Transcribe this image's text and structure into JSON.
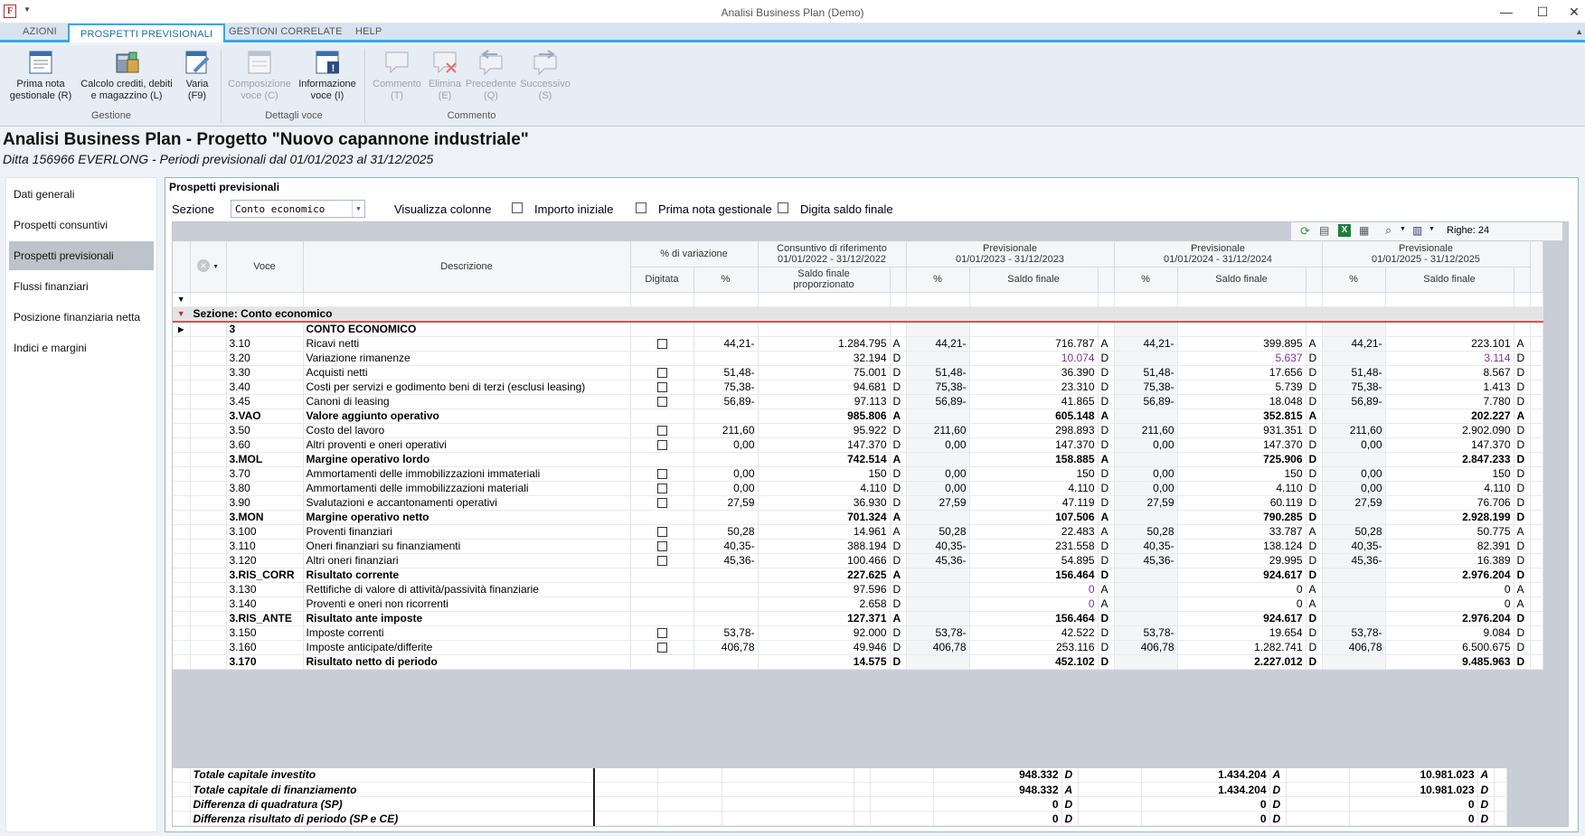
{
  "window": {
    "title": "Analisi Business Plan  (Demo)",
    "app_icon": "F",
    "controls": [
      "minimize-icon",
      "maximize-icon",
      "close-icon"
    ]
  },
  "ribbon_tabs": [
    "AZIONI",
    "PROSPETTI PREVISIONALI",
    "GESTIONI CORRELATE",
    "HELP"
  ],
  "ribbon": {
    "buttons": [
      {
        "l1": "Prima nota",
        "l2": "gestionale (R)",
        "icon": "document-icon"
      },
      {
        "l1": "Calcolo crediti, debiti",
        "l2": "e magazzino (L)",
        "icon": "calculator-icon"
      },
      {
        "l1": "Varia",
        "l2": "(F9)",
        "icon": "edit-icon"
      },
      {
        "l1": "Composizione",
        "l2": "voce (C)",
        "icon": "composition-icon"
      },
      {
        "l1": "Informazione",
        "l2": "voce (I)",
        "icon": "info-icon"
      },
      {
        "l1": "Commento",
        "l2": "(T)",
        "icon": "comment-icon"
      },
      {
        "l1": "Elimina",
        "l2": "(E)",
        "icon": "delete-comment-icon"
      },
      {
        "l1": "Precedente",
        "l2": "(Q)",
        "icon": "previous-icon"
      },
      {
        "l1": "Successivo",
        "l2": "(S)",
        "icon": "next-icon"
      }
    ],
    "groups": [
      "Gestione",
      "Dettagli voce",
      "Commento"
    ]
  },
  "header": {
    "title": "Analisi Business Plan - Progetto \"Nuovo capannone industriale\"",
    "subtitle": "Ditta 156966 EVERLONG - Periodi previsionali dal 01/01/2023 al 31/12/2025"
  },
  "nav": [
    "Dati generali",
    "Prospetti consuntivi",
    "Prospetti previsionali",
    "Flussi finanziari",
    "Posizione finanziaria netta",
    "Indici e margini"
  ],
  "panel": {
    "title": "Prospetti previsionali",
    "sezione_label": "Sezione",
    "sezione_value": "Conto economico",
    "visualizza": "Visualizza colonne",
    "chk1": "Importo iniziale",
    "chk2": "Prima nota gestionale",
    "chk3": "Digita saldo finale",
    "righe": "Righe: 24"
  },
  "cols": {
    "voce": "Voce",
    "descrizione": "Descrizione",
    "var": "% di variazione",
    "digitata": "Digitata",
    "pct": "%",
    "cons1": "Consuntivo di riferimento",
    "cons2": "01/01/2022 - 31/12/2022",
    "saldo_prop": "Saldo finale",
    "saldo_prop2": "proporzionato",
    "prev": "Previsionale",
    "p1": "01/01/2023 - 31/12/2023",
    "p2": "01/01/2024 - 31/12/2024",
    "p3": "01/01/2025 - 31/12/2025",
    "saldo": "Saldo finale"
  },
  "section": "Sezione:  Conto economico",
  "rows": [
    {
      "v": "3",
      "d": "CONTO ECONOMICO",
      "b": 1,
      "chk": 0,
      "p": "",
      "s": "",
      "sa": "",
      "p1": "",
      "v1": "",
      "a1": "",
      "p2": "",
      "v2": "",
      "a2": "",
      "p3": "",
      "v3": "",
      "a3": ""
    },
    {
      "v": "3.10",
      "d": "Ricavi netti",
      "chk": 1,
      "p": "44,21-",
      "s": "1.284.795",
      "sa": "A",
      "p1": "44,21-",
      "v1": "716.787",
      "a1": "A",
      "p2": "44,21-",
      "v2": "399.895",
      "a2": "A",
      "p3": "44,21-",
      "v3": "223.101",
      "a3": "A"
    },
    {
      "v": "3.20",
      "d": "Variazione rimanenze",
      "chk": 0,
      "p": "",
      "s": "32.194",
      "sa": "D",
      "p1": "",
      "v1": "10.074",
      "a1": "D",
      "p2": "",
      "v2": "5.637",
      "a2": "D",
      "p3": "",
      "v3": "3.114",
      "a3": "D",
      "pur": 1
    },
    {
      "v": "3.30",
      "d": "Acquisti netti",
      "chk": 1,
      "p": "51,48-",
      "s": "75.001",
      "sa": "D",
      "p1": "51,48-",
      "v1": "36.390",
      "a1": "D",
      "p2": "51,48-",
      "v2": "17.656",
      "a2": "D",
      "p3": "51,48-",
      "v3": "8.567",
      "a3": "D"
    },
    {
      "v": "3.40",
      "d": "Costi per servizi e godimento beni di terzi (esclusi leasing)",
      "chk": 1,
      "p": "75,38-",
      "s": "94.681",
      "sa": "D",
      "p1": "75,38-",
      "v1": "23.310",
      "a1": "D",
      "p2": "75,38-",
      "v2": "5.739",
      "a2": "D",
      "p3": "75,38-",
      "v3": "1.413",
      "a3": "D"
    },
    {
      "v": "3.45",
      "d": "Canoni di leasing",
      "chk": 1,
      "p": "56,89-",
      "s": "97.113",
      "sa": "D",
      "p1": "56,89-",
      "v1": "41.865",
      "a1": "D",
      "p2": "56,89-",
      "v2": "18.048",
      "a2": "D",
      "p3": "56,89-",
      "v3": "7.780",
      "a3": "D"
    },
    {
      "v": "3.VAO",
      "d": "Valore aggiunto operativo",
      "b": 1,
      "chk": 0,
      "p": "",
      "s": "985.806",
      "sa": "A",
      "p1": "",
      "v1": "605.148",
      "a1": "A",
      "p2": "",
      "v2": "352.815",
      "a2": "A",
      "p3": "",
      "v3": "202.227",
      "a3": "A"
    },
    {
      "v": "3.50",
      "d": "Costo del lavoro",
      "chk": 1,
      "p": "211,60",
      "s": "95.922",
      "sa": "D",
      "p1": "211,60",
      "v1": "298.893",
      "a1": "D",
      "p2": "211,60",
      "v2": "931.351",
      "a2": "D",
      "p3": "211,60",
      "v3": "2.902.090",
      "a3": "D"
    },
    {
      "v": "3.60",
      "d": "Altri proventi e oneri operativi",
      "chk": 1,
      "p": "0,00",
      "s": "147.370",
      "sa": "D",
      "p1": "0,00",
      "v1": "147.370",
      "a1": "D",
      "p2": "0,00",
      "v2": "147.370",
      "a2": "D",
      "p3": "0,00",
      "v3": "147.370",
      "a3": "D"
    },
    {
      "v": "3.MOL",
      "d": "Margine operativo lordo",
      "b": 1,
      "chk": 0,
      "p": "",
      "s": "742.514",
      "sa": "A",
      "p1": "",
      "v1": "158.885",
      "a1": "A",
      "p2": "",
      "v2": "725.906",
      "a2": "D",
      "p3": "",
      "v3": "2.847.233",
      "a3": "D"
    },
    {
      "v": "3.70",
      "d": "Ammortamenti delle immobilizzazioni immateriali",
      "chk": 1,
      "p": "0,00",
      "s": "150",
      "sa": "D",
      "p1": "0,00",
      "v1": "150",
      "a1": "D",
      "p2": "0,00",
      "v2": "150",
      "a2": "D",
      "p3": "0,00",
      "v3": "150",
      "a3": "D"
    },
    {
      "v": "3.80",
      "d": "Ammortamenti delle immobilizzazioni materiali",
      "chk": 1,
      "p": "0,00",
      "s": "4.110",
      "sa": "D",
      "p1": "0,00",
      "v1": "4.110",
      "a1": "D",
      "p2": "0,00",
      "v2": "4.110",
      "a2": "D",
      "p3": "0,00",
      "v3": "4.110",
      "a3": "D"
    },
    {
      "v": "3.90",
      "d": "Svalutazioni e accantonamenti operativi",
      "chk": 1,
      "p": "27,59",
      "s": "36.930",
      "sa": "D",
      "p1": "27,59",
      "v1": "47.119",
      "a1": "D",
      "p2": "27,59",
      "v2": "60.119",
      "a2": "D",
      "p3": "27,59",
      "v3": "76.706",
      "a3": "D"
    },
    {
      "v": "3.MON",
      "d": "Margine operativo netto",
      "b": 1,
      "chk": 0,
      "p": "",
      "s": "701.324",
      "sa": "A",
      "p1": "",
      "v1": "107.506",
      "a1": "A",
      "p2": "",
      "v2": "790.285",
      "a2": "D",
      "p3": "",
      "v3": "2.928.199",
      "a3": "D"
    },
    {
      "v": "3.100",
      "d": "Proventi finanziari",
      "chk": 1,
      "p": "50,28",
      "s": "14.961",
      "sa": "A",
      "p1": "50,28",
      "v1": "22.483",
      "a1": "A",
      "p2": "50,28",
      "v2": "33.787",
      "a2": "A",
      "p3": "50,28",
      "v3": "50.775",
      "a3": "A"
    },
    {
      "v": "3.110",
      "d": "Oneri finanziari su finanziamenti",
      "chk": 1,
      "p": "40,35-",
      "s": "388.194",
      "sa": "D",
      "p1": "40,35-",
      "v1": "231.558",
      "a1": "D",
      "p2": "40,35-",
      "v2": "138.124",
      "a2": "D",
      "p3": "40,35-",
      "v3": "82.391",
      "a3": "D"
    },
    {
      "v": "3.120",
      "d": "Altri oneri finanziari",
      "chk": 1,
      "p": "45,36-",
      "s": "100.466",
      "sa": "D",
      "p1": "45,36-",
      "v1": "54.895",
      "a1": "D",
      "p2": "45,36-",
      "v2": "29.995",
      "a2": "D",
      "p3": "45,36-",
      "v3": "16.389",
      "a3": "D"
    },
    {
      "v": "3.RIS_CORR",
      "d": "Risultato corrente",
      "b": 1,
      "chk": 0,
      "p": "",
      "s": "227.625",
      "sa": "A",
      "p1": "",
      "v1": "156.464",
      "a1": "D",
      "p2": "",
      "v2": "924.617",
      "a2": "D",
      "p3": "",
      "v3": "2.976.204",
      "a3": "D"
    },
    {
      "v": "3.130",
      "d": "Rettifiche di valore di attività/passività finanziarie",
      "chk": 0,
      "p": "",
      "s": "97.596",
      "sa": "D",
      "p1": "",
      "v1": "0",
      "a1": "A",
      "p2": "",
      "v2": "0",
      "a2": "A",
      "p3": "",
      "v3": "0",
      "a3": "A",
      "pur1": 1
    },
    {
      "v": "3.140",
      "d": "Proventi e oneri non ricorrenti",
      "chk": 0,
      "p": "",
      "s": "2.658",
      "sa": "D",
      "p1": "",
      "v1": "0",
      "a1": "A",
      "p2": "",
      "v2": "0",
      "a2": "A",
      "p3": "",
      "v3": "0",
      "a3": "A",
      "pur1": 1
    },
    {
      "v": "3.RIS_ANTE",
      "d": "Risultato ante imposte",
      "b": 1,
      "chk": 0,
      "p": "",
      "s": "127.371",
      "sa": "A",
      "p1": "",
      "v1": "156.464",
      "a1": "D",
      "p2": "",
      "v2": "924.617",
      "a2": "D",
      "p3": "",
      "v3": "2.976.204",
      "a3": "D"
    },
    {
      "v": "3.150",
      "d": "Imposte correnti",
      "chk": 1,
      "p": "53,78-",
      "s": "92.000",
      "sa": "D",
      "p1": "53,78-",
      "v1": "42.522",
      "a1": "D",
      "p2": "53,78-",
      "v2": "19.654",
      "a2": "D",
      "p3": "53,78-",
      "v3": "9.084",
      "a3": "D"
    },
    {
      "v": "3.160",
      "d": "Imposte anticipate/differite",
      "chk": 1,
      "p": "406,78",
      "s": "49.946",
      "sa": "D",
      "p1": "406,78",
      "v1": "253.116",
      "a1": "D",
      "p2": "406,78",
      "v2": "1.282.741",
      "a2": "D",
      "p3": "406,78",
      "v3": "6.500.675",
      "a3": "D"
    },
    {
      "v": "3.170",
      "d": "Risultato netto di periodo",
      "b": 1,
      "chk": 0,
      "p": "",
      "s": "14.575",
      "sa": "D",
      "p1": "",
      "v1": "452.102",
      "a1": "D",
      "p2": "",
      "v2": "2.227.012",
      "a2": "D",
      "p3": "",
      "v3": "9.485.963",
      "a3": "D"
    }
  ],
  "totals": [
    {
      "l": "Totale capitale investito",
      "v1": "948.332",
      "a1": "D",
      "v2": "1.434.204",
      "a2": "A",
      "v3": "10.981.023",
      "a3": "A"
    },
    {
      "l": "Totale capitale di finanziamento",
      "v1": "948.332",
      "a1": "A",
      "v2": "1.434.204",
      "a2": "D",
      "v3": "10.981.023",
      "a3": "D"
    },
    {
      "l": "Differenza di quadratura (SP)",
      "v1": "0",
      "a1": "D",
      "v2": "0",
      "a2": "D",
      "v3": "0",
      "a3": "D"
    },
    {
      "l": "Differenza risultato di periodo (SP e CE)",
      "v1": "0",
      "a1": "D",
      "v2": "0",
      "a2": "D",
      "v3": "0",
      "a3": "D"
    }
  ]
}
